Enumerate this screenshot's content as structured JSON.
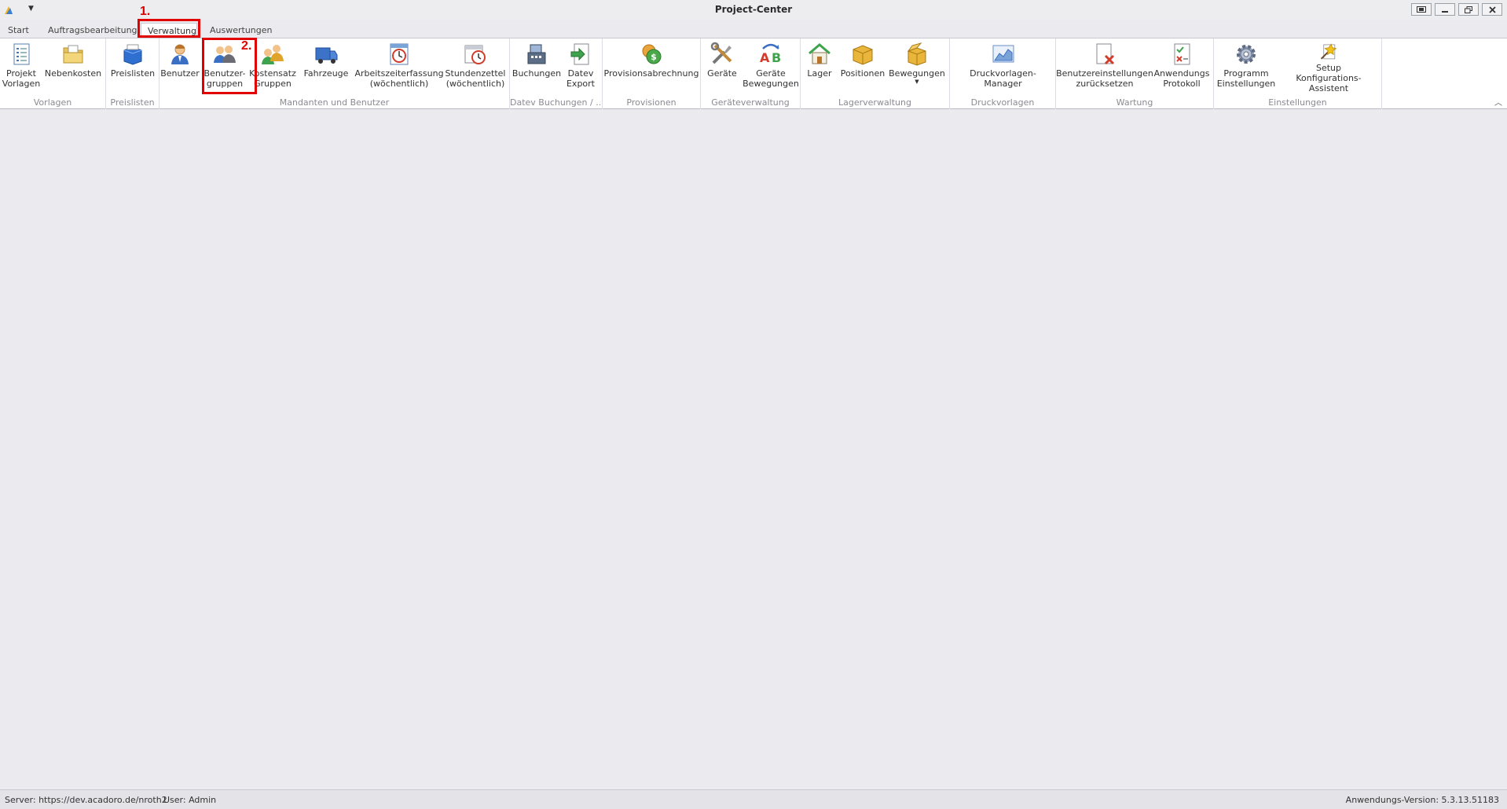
{
  "window": {
    "title": "Project-Center"
  },
  "tabs": [
    {
      "label": "Start"
    },
    {
      "label": "Auftragsbearbeitung"
    },
    {
      "label": "Verwaltung"
    },
    {
      "label": "Auswertungen"
    }
  ],
  "annotations": {
    "step1": "1.",
    "step2": "2."
  },
  "ribbon": {
    "groups": [
      {
        "label": "Vorlagen"
      },
      {
        "label": "Preislisten"
      },
      {
        "label": "Mandanten und Benutzer"
      },
      {
        "label": "Datev Buchungen / ..."
      },
      {
        "label": "Provisionen"
      },
      {
        "label": "Geräteverwaltung"
      },
      {
        "label": "Lagerverwaltung"
      },
      {
        "label": "Druckvorlagen"
      },
      {
        "label": "Wartung"
      },
      {
        "label": "Einstellungen"
      }
    ],
    "buttons": {
      "projekt_vorlagen": "Projekt\nVorlagen",
      "nebenkosten": "Nebenkosten",
      "preislisten": "Preislisten",
      "benutzer": "Benutzer",
      "benutzergruppen": "Benutzer-\ngruppen",
      "kostensatz": "Kostensatz\nGruppen",
      "fahrzeuge": "Fahrzeuge",
      "arbeitszeit": "Arbeitszeiterfassung\n(wöchentlich)",
      "stundenzettel": "Stundenzettel\n(wöchentlich)",
      "buchungen": "Buchungen",
      "datev_export": "Datev\nExport",
      "provisionsabrechnung": "Provisionsabrechnung",
      "geraete": "Geräte",
      "geraete_bewegungen": "Geräte\nBewegungen",
      "lager": "Lager",
      "positionen": "Positionen",
      "bewegungen": "Bewegungen",
      "druckvorlagen_manager": "Druckvorlagen-Manager",
      "benutzereinstellungen": "Benutzereinstellungen\nzurücksetzen",
      "anwendungs_protokoll": "Anwendungs\nProtokoll",
      "programm_einstellungen": "Programm\nEinstellungen",
      "setup_assistent": "Setup\nKonfigurations-Assistent"
    }
  },
  "status": {
    "server": "Server: https://dev.acadoro.de/nroth2",
    "user": "User: Admin",
    "version": "Anwendungs-Version: 5.3.13.51183"
  }
}
